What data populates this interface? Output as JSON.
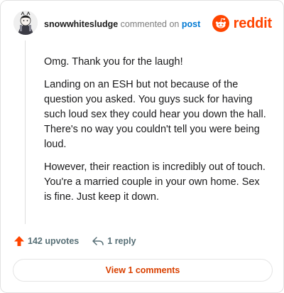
{
  "comment": {
    "username": "snowwhitesludge",
    "commented_on": "commented on",
    "post_link": "post",
    "paragraphs": [
      "Omg. Thank you for the laugh!",
      "Landing on an ESH but not because of the question you asked. You guys suck for having such loud sex they could hear you down the hall. There's no way you couldn't tell you were being loud.",
      "However, their reaction is incredibly out of touch. You're a married couple in your own home. Sex is fine. Just keep it down."
    ]
  },
  "brand": {
    "name": "reddit",
    "color": "#ff4500"
  },
  "actions": {
    "upvotes": "142 upvotes",
    "upvote_icon": "upvote-arrow-icon",
    "upvote_color": "#ff4500",
    "replies": "1 reply",
    "reply_icon": "reply-arrow-icon"
  },
  "view_comments": "View 1 comments",
  "colors": {
    "link": "#0079d3",
    "muted": "#7c7c7c",
    "view_button_text": "#d94000"
  }
}
